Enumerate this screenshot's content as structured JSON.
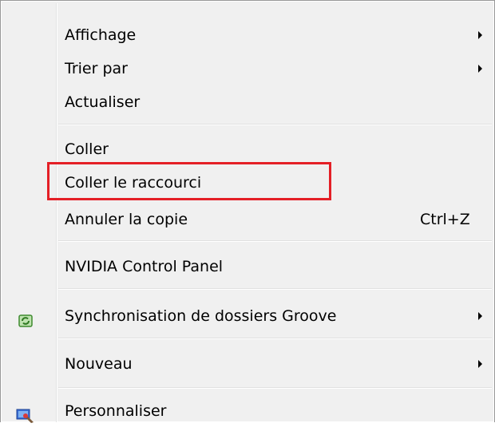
{
  "menu": {
    "items": [
      {
        "label": "Affichage",
        "submenu": true
      },
      {
        "label": "Trier par",
        "submenu": true
      },
      {
        "label": "Actualiser",
        "submenu": false
      },
      {
        "label": "Coller",
        "submenu": false
      },
      {
        "label": "Coller le raccourci",
        "submenu": false,
        "highlighted": true
      },
      {
        "label": "Annuler la copie",
        "shortcut": "Ctrl+Z",
        "submenu": false
      },
      {
        "label": "NVIDIA Control Panel",
        "submenu": false
      },
      {
        "label": "Synchronisation de dossiers Groove",
        "submenu": true,
        "icon": "groove-sync-icon"
      },
      {
        "label": "Nouveau",
        "submenu": true
      },
      {
        "label": "Personnaliser",
        "submenu": false,
        "icon": "personalize-display-icon"
      }
    ]
  },
  "colors": {
    "menu_background": "#f0f0f0",
    "highlight_border": "#e41f26",
    "text": "#000000"
  }
}
